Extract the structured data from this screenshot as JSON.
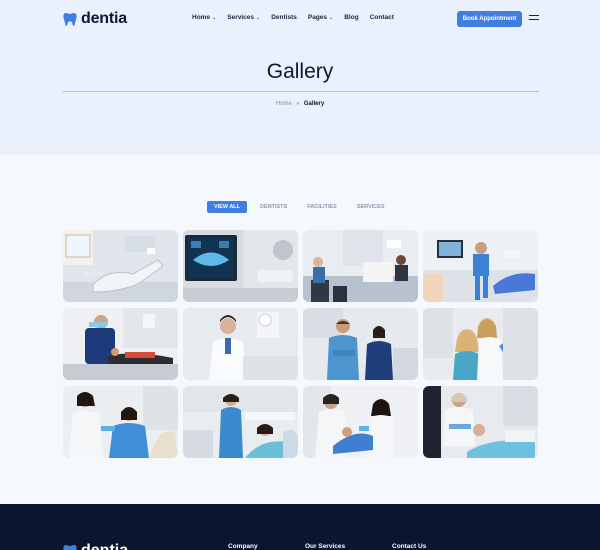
{
  "brand": {
    "name": "dentia",
    "accent": "#3f7fe0",
    "dark": "#0c1530"
  },
  "nav": {
    "items": [
      {
        "label": "Home",
        "dropdown": true
      },
      {
        "label": "Services",
        "dropdown": true
      },
      {
        "label": "Dentists",
        "dropdown": false
      },
      {
        "label": "Pages",
        "dropdown": true
      },
      {
        "label": "Blog",
        "dropdown": false
      },
      {
        "label": "Contact",
        "dropdown": false
      }
    ],
    "cta": "Book Appointment"
  },
  "hero": {
    "title": "Gallery"
  },
  "breadcrumb": {
    "home": "Home",
    "separator": "›",
    "current": "Gallery"
  },
  "filters": [
    "VIEW ALL",
    "DENTISTS",
    "FACILITIES",
    "SERVICES"
  ],
  "gallery": [
    {
      "name": "dental-chair-room"
    },
    {
      "name": "xray-monitors"
    },
    {
      "name": "clinic-reception"
    },
    {
      "name": "dentist-office"
    },
    {
      "name": "dentist-treating-patient"
    },
    {
      "name": "female-dentist-portrait"
    },
    {
      "name": "dental-team"
    },
    {
      "name": "happy-patients"
    },
    {
      "name": "patient-check-up"
    },
    {
      "name": "nurse-with-patient"
    },
    {
      "name": "dental-exam"
    },
    {
      "name": "dental-procedure"
    }
  ],
  "footer": {
    "brand": "dentia",
    "columns": [
      "Company",
      "Our Services",
      "Contact Us"
    ]
  }
}
